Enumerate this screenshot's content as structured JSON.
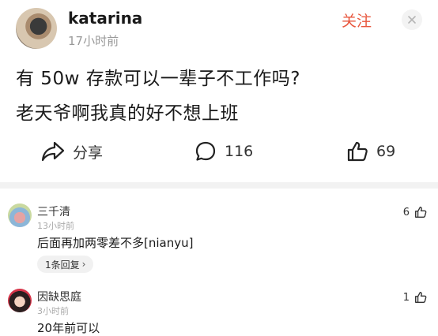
{
  "post": {
    "username": "katarina",
    "time": "17小时前",
    "follow_label": "关注",
    "line1": "有 50w 存款可以一辈子不工作吗?",
    "line2": "老天爷啊我真的好不想上班",
    "actions": {
      "share_label": "分享",
      "comment_count": "116",
      "like_count": "69"
    }
  },
  "comments": [
    {
      "name": "三千清",
      "time": "13小时前",
      "text": "后面再加两零差不多[nianyu]",
      "likes": "6",
      "reply_label": "1条回复",
      "reply_chevron": "›"
    },
    {
      "name": "因缺思庭",
      "time": "3小时前",
      "text": "20年前可以",
      "likes": "1"
    }
  ],
  "colors": {
    "accent": "#e8573e",
    "muted": "#9a9a9a",
    "divider": "#f2f2f2"
  }
}
